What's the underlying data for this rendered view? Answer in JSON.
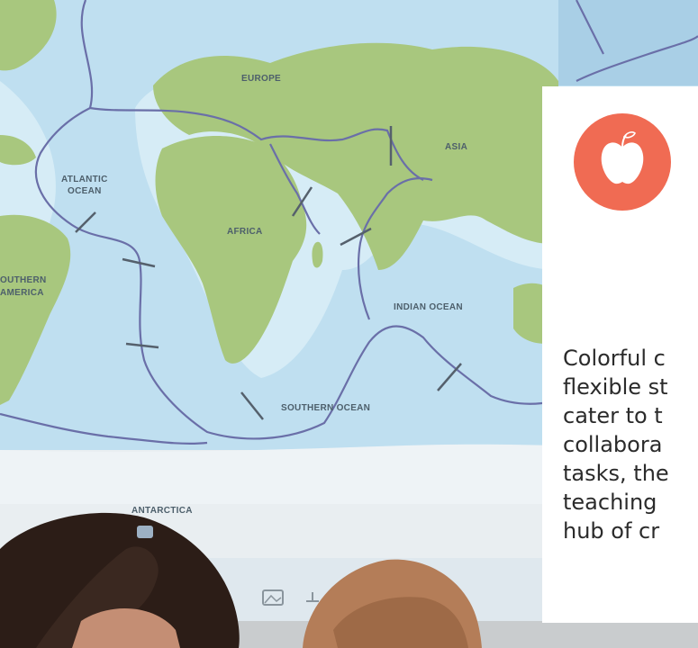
{
  "map": {
    "labels": {
      "europe": "EUROPE",
      "asia": "ASIA",
      "atlantic_line1": "ATLANTIC",
      "atlantic_line2": "OCEAN",
      "africa": "AFRICA",
      "southern_america_line1": "OUTHERN",
      "southern_america_line2": "AMERICA",
      "indian_ocean": "INDIAN OCEAN",
      "southern_ocean": "SOUTHERN OCEAN",
      "antarctica": "ANTARCTICA"
    },
    "colors": {
      "ocean": "#bfdff0",
      "shelf": "#d6ecf6",
      "land": "#a8c77e",
      "plate_line": "#6a6fa8"
    }
  },
  "card": {
    "icon": "apple-icon",
    "icon_color": "#f06b53",
    "text": "Colorful c\nflexible st\ncater to t\ncollabora\ntasks, the\nteaching\nhub of cr"
  }
}
